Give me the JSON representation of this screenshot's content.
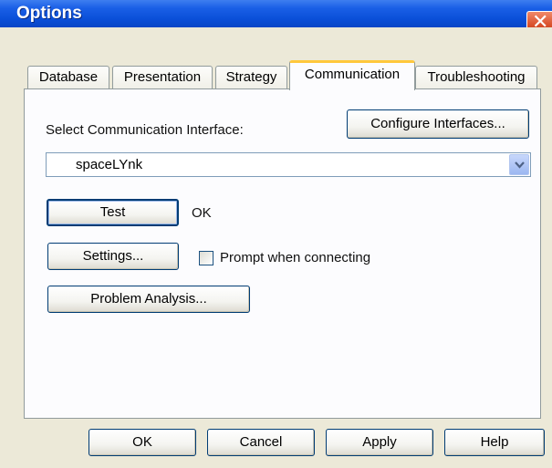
{
  "window": {
    "title": "Options"
  },
  "tabs": [
    "Database",
    "Presentation",
    "Strategy",
    "Communication",
    "Troubleshooting"
  ],
  "communication": {
    "select_label": "Select Communication Interface:",
    "configure_button": "Configure Interfaces...",
    "interface_value": "spaceLYnk",
    "test_button": "Test",
    "test_status": "OK",
    "settings_button": "Settings...",
    "prompt_checkbox_label": "Prompt when connecting",
    "prompt_checked": false,
    "problem_button": "Problem Analysis..."
  },
  "footer": {
    "ok": "OK",
    "cancel": "Cancel",
    "apply": "Apply",
    "help": "Help"
  },
  "colors": {
    "titlebar": "#0a4fd8",
    "dialog_bg": "#ece9d8",
    "active_tab_accent": "#ffc83c",
    "close_button": "#d9512c"
  },
  "icons": {
    "close": "close-icon",
    "dropdown": "chevron-down-icon"
  }
}
